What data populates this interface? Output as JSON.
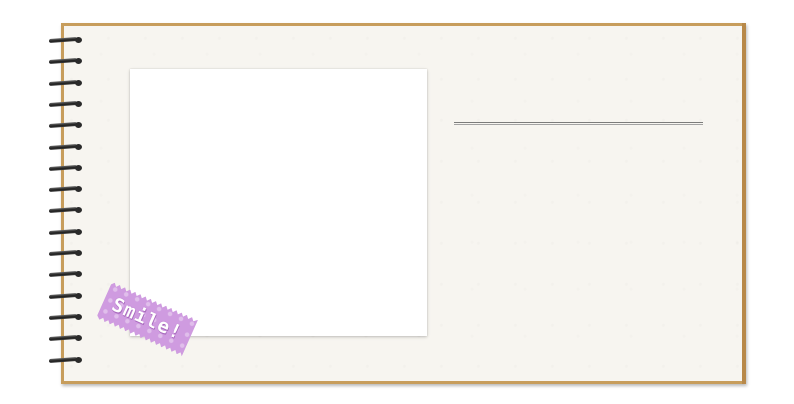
{
  "sticker": {
    "text": "Smile!",
    "color": "#cf9be0"
  },
  "notebook": {
    "border_color": "#c79d5c",
    "paper_color": "#f7f5f0"
  },
  "photo_frame": {
    "color": "#ffffff"
  }
}
